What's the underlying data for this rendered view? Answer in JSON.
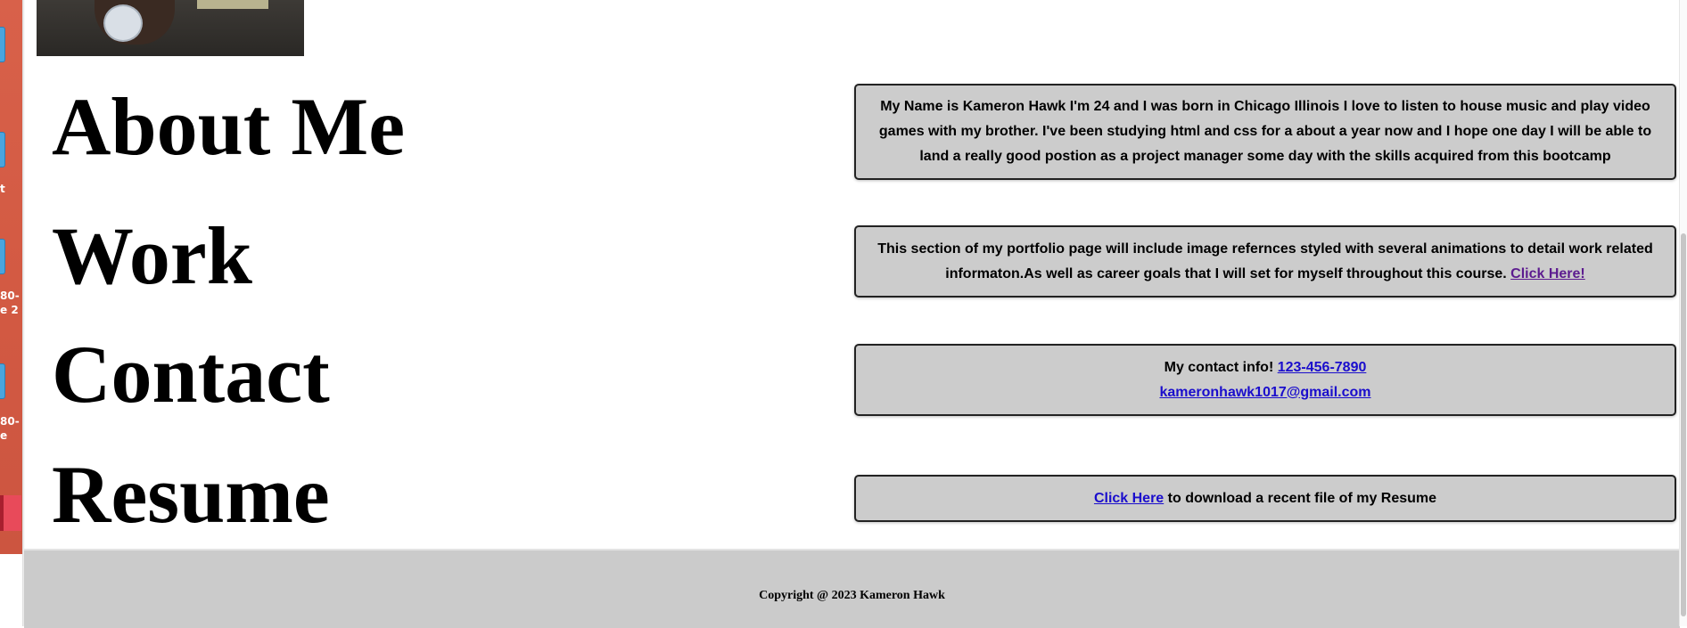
{
  "desktop": {
    "labels": [
      "t",
      "80-",
      "e 2",
      "80-",
      "e"
    ]
  },
  "sections": {
    "about": {
      "heading": "About Me",
      "text": "My Name is Kameron Hawk I'm 24 and I was born in Chicago Illinois I love to listen to house music and play video games with my brother. I've been studying html and css for a about a year now and I hope one day I will be able to land a really good postion as a project manager some day with the skills acquired from this bootcamp"
    },
    "work": {
      "heading": "Work",
      "text": "This section of my portfolio page will include image refernces styled with several animations to detail work related informaton.As well as career goals that I will set for myself throughout this course. ",
      "link": "Click Here!"
    },
    "contact": {
      "heading": "Contact",
      "text": "My contact info! ",
      "phone": "123-456-7890",
      "email": "kameronhawk1017@gmail.com"
    },
    "resume": {
      "heading": "Resume",
      "link": "Click Here",
      "text": " to download a recent file of my Resume"
    }
  },
  "footer": {
    "copyright": "Copyright @ 2023 Kameron Hawk"
  },
  "colors": {
    "box_background": "#cccccc",
    "link": "#1a0dcc",
    "visited_link": "#5c1b8f",
    "footer_background": "#cbcbcb"
  }
}
